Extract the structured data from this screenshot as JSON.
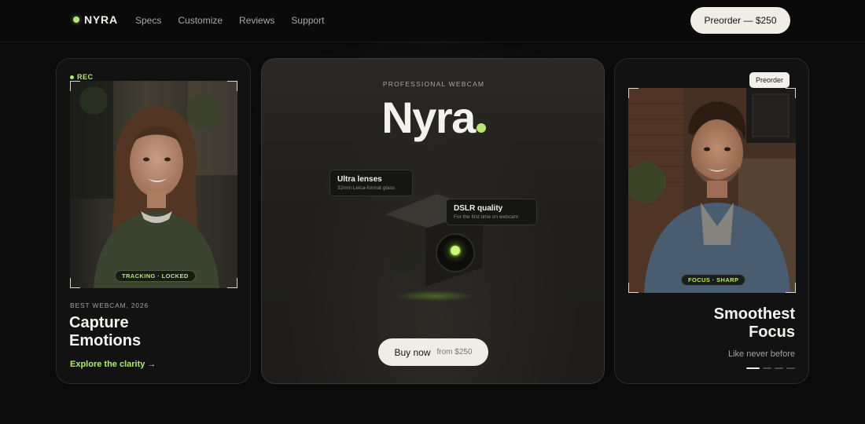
{
  "nav": {
    "logo": "NYRA",
    "links": [
      "Specs",
      "Customize",
      "Reviews",
      "Support"
    ],
    "cta": "Preorder — $250"
  },
  "left_card": {
    "rec": "REC",
    "tag": "TRACKING · LOCKED",
    "eyebrow": "BEST WEBCAM, 2026",
    "title_line1": "Capture",
    "title_line2": "Emotions",
    "link": "Explore the clarity →"
  },
  "mid_card": {
    "eyebrow": "PROFESSIONAL WEBCAM",
    "brand": "Nyra",
    "chip1": {
      "title": "Ultra lenses",
      "sub": "32mm Leica-format glass"
    },
    "chip2": {
      "title": "DSLR quality",
      "sub": "For the first time on webcam"
    },
    "buy_label": "Buy now",
    "buy_price": "from $250"
  },
  "right_card": {
    "badge": "Preorder",
    "tag": "FOCUS · SHARP",
    "title_line1": "Smoothest",
    "title_line2": "Focus",
    "subtitle": "Like never before",
    "carousel_active_index": 0
  },
  "colors": {
    "accent": "#b4e872",
    "background": "#0b0b0c",
    "button": "#efede6"
  }
}
